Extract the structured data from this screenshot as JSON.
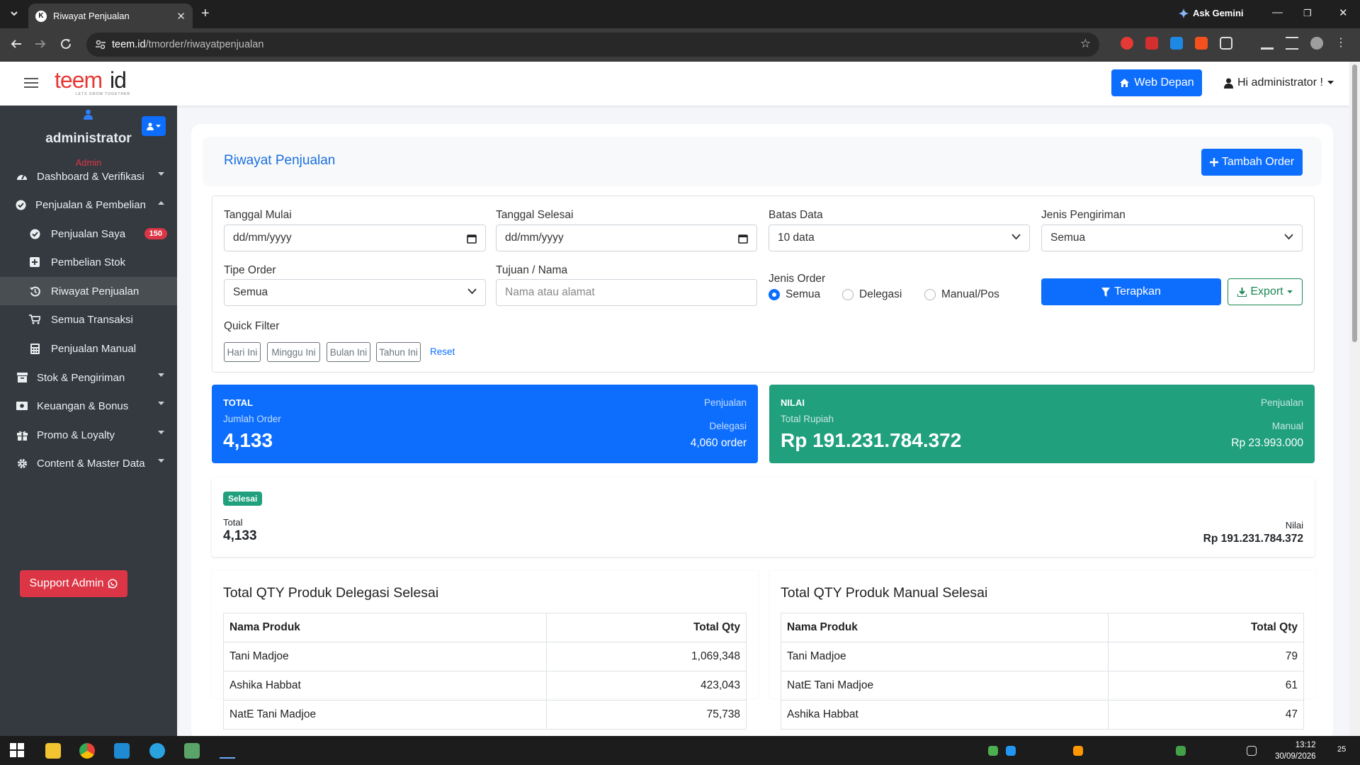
{
  "browser": {
    "tab_title": "Riwayat Penjualan",
    "url_host": "teem.id",
    "url_path": "/tmorder/riwayatpenjualan",
    "gemini_label": "Ask Gemini"
  },
  "topnav": {
    "logo_text": "teemid",
    "logo_tagline": "LETS GROW TOGETHER",
    "web_button": "Web Depan",
    "user_greeting": "Hi administrator !"
  },
  "sidebar": {
    "user_name": "administrator",
    "user_role": "Admin",
    "items": [
      {
        "label": "Dashboard & Verifikasi"
      },
      {
        "label": "Penjualan & Pembelian"
      },
      {
        "label": "Penjualan Saya",
        "badge": "150"
      },
      {
        "label": "Pembelian Stok"
      },
      {
        "label": "Riwayat Penjualan"
      },
      {
        "label": "Semua Transaksi"
      },
      {
        "label": "Penjualan Manual"
      },
      {
        "label": "Stok & Pengiriman"
      },
      {
        "label": "Keuangan & Bonus"
      },
      {
        "label": "Promo & Loyalty"
      },
      {
        "label": "Content & Master Data"
      }
    ],
    "support_button": "Support Admin"
  },
  "header": {
    "title": "Riwayat Penjualan",
    "add_button": "Tambah Order"
  },
  "filter": {
    "tanggal_mulai_label": "Tanggal Mulai",
    "tanggal_mulai_value": "dd/mm/yyyy",
    "tanggal_selesai_label": "Tanggal Selesai",
    "tanggal_selesai_value": "dd/mm/yyyy",
    "batas_data_label": "Batas Data",
    "batas_data_value": "10 data",
    "jenis_pengiriman_label": "Jenis Pengiriman",
    "jenis_pengiriman_value": "Semua",
    "tipe_order_label": "Tipe Order",
    "tipe_order_value": "Semua",
    "tujuan_label": "Tujuan / Nama",
    "tujuan_placeholder": "Nama atau alamat",
    "jenis_order_label": "Jenis Order",
    "jenis_order_options": [
      "Semua",
      "Delegasi",
      "Manual/Pos"
    ],
    "jenis_order_selected": "Semua",
    "apply_button": "Terapkan",
    "export_button": "Export",
    "quick_filter_label": "Quick Filter",
    "quick_filters": [
      "Hari Ini",
      "Minggu Ini",
      "Bulan Ini",
      "Tahun Ini"
    ],
    "reset_link": "Reset"
  },
  "stats": {
    "total": {
      "key": "TOTAL",
      "sub": "Jumlah Order",
      "value": "4,133",
      "right_top": "Penjualan",
      "right_mid": "Delegasi",
      "right_val": "4,060 order",
      "color": "#0d6efd"
    },
    "nilai": {
      "key": "NILAI",
      "sub": "Total Rupiah",
      "value": "Rp 191.231.784.372",
      "right_top": "Penjualan",
      "right_mid": "Manual",
      "right_val": "Rp 23.993.000",
      "color": "#20a07d"
    }
  },
  "summary": {
    "badge": "Selesai",
    "total_label": "Total",
    "total_value": "4,133",
    "nilai_label": "Nilai",
    "nilai_value": "Rp 191.231.784.372"
  },
  "tables": {
    "delegasi": {
      "title": "Total QTY Produk Delegasi Selesai",
      "col_name": "Nama Produk",
      "col_qty": "Total Qty",
      "rows": [
        {
          "name": "Tani Madjoe",
          "qty": "1,069,348"
        },
        {
          "name": "Ashika Habbat",
          "qty": "423,043"
        },
        {
          "name": "NatE Tani Madjoe",
          "qty": "75,738"
        }
      ]
    },
    "manual": {
      "title": "Total QTY Produk Manual Selesai",
      "col_name": "Nama Produk",
      "col_qty": "Total Qty",
      "rows": [
        {
          "name": "Tani Madjoe",
          "qty": "79"
        },
        {
          "name": "NatE Tani Madjoe",
          "qty": "61"
        },
        {
          "name": "Ashika Habbat",
          "qty": "47"
        }
      ]
    }
  },
  "taskbar": {
    "time": "13:12",
    "date": "30/09/2026",
    "notif_count": "25"
  }
}
